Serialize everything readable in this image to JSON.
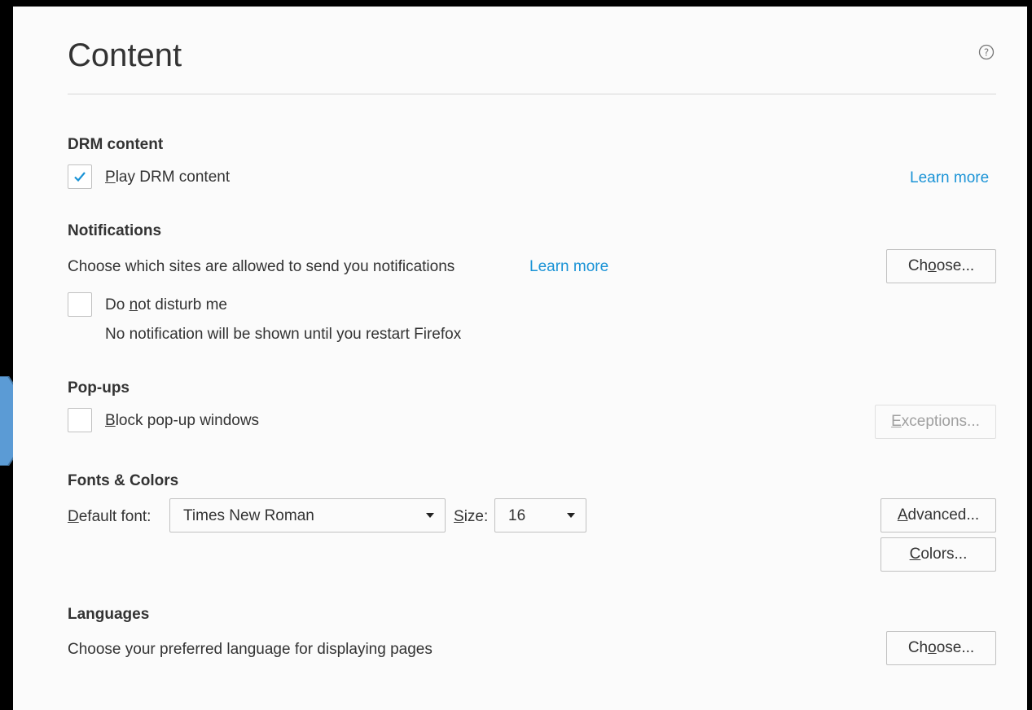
{
  "title": "Content",
  "help_icon": "question-circle-icon",
  "drm": {
    "heading": "DRM content",
    "checkbox_label": "Play DRM content",
    "checked": true,
    "learn_more": "Learn more"
  },
  "notifications": {
    "heading": "Notifications",
    "description": "Choose which sites are allowed to send you notifications",
    "learn_more": "Learn more",
    "choose_button": "Choose...",
    "dnd_label": "Do not disturb me",
    "dnd_checked": false,
    "dnd_note": "No notification will be shown until you restart Firefox"
  },
  "popups": {
    "heading": "Pop-ups",
    "checkbox_label": "Block pop-up windows",
    "checked": false,
    "exceptions_button": "Exceptions..."
  },
  "fonts": {
    "heading": "Fonts & Colors",
    "default_font_label": "Default font:",
    "default_font_value": "Times New Roman",
    "size_label": "Size:",
    "size_value": "16",
    "advanced_button": "Advanced...",
    "colors_button": "Colors..."
  },
  "languages": {
    "heading": "Languages",
    "description": "Choose your preferred language for displaying pages",
    "choose_button": "Choose..."
  },
  "colors": {
    "link": "#1a93d6",
    "arrow_fill": "#5b9bd5",
    "arrow_stroke": "#41719c"
  }
}
